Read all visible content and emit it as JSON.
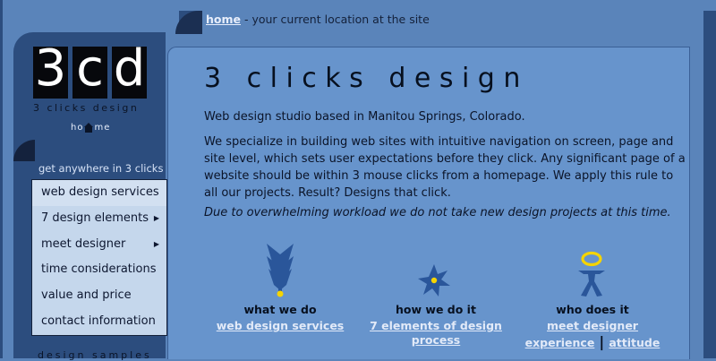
{
  "breadcrumb": {
    "link": "home",
    "rest": " - your current location at the site"
  },
  "logo": {
    "letters": [
      "3",
      "c",
      "d"
    ],
    "subtitle": "3 clicks design"
  },
  "home_link": {
    "before": "ho",
    "after": "me"
  },
  "sidebar": {
    "heading": "get anywhere in 3 clicks",
    "menu": [
      {
        "label": "web design services",
        "arrow": ""
      },
      {
        "label": "7 design elements",
        "arrow": "▶"
      },
      {
        "label": "meet designer",
        "arrow": "▶"
      },
      {
        "label": "time considerations",
        "arrow": ""
      },
      {
        "label": "value and price",
        "arrow": ""
      },
      {
        "label": "contact information",
        "arrow": ""
      }
    ],
    "footer": "design samples"
  },
  "main": {
    "title": "3 clicks design",
    "p1": "Web design studio based in Manitou Springs, Colorado.",
    "p2": "We specialize in building web sites with intuitive navigation on screen, page and site level, which sets user expectations before they click. Any significant page of a website should be within 3 mouse clicks from a homepage. We apply this rule to all our projects. Result? Designs that click.",
    "p3": "Due to overwhelming workload we do not take new design projects at this time."
  },
  "columns": [
    {
      "label": "what we do",
      "icon": "wheat-icon",
      "links": [
        "web design services"
      ]
    },
    {
      "label": "how we do it",
      "icon": "star-gear-icon",
      "links": [
        "7 elements of design process"
      ]
    },
    {
      "label": "who does it",
      "icon": "person-halo-icon",
      "links": [
        "meet designer",
        "experience",
        "attitude"
      ],
      "separator": "|"
    }
  ],
  "colors": {
    "page_bg": "#5a84ba",
    "frame": "#2c4d7e",
    "content_bg": "#6794cc",
    "menu_bg": "#c5d7ec",
    "icon_blue": "#2a569a",
    "icon_yellow": "#f5d400"
  }
}
